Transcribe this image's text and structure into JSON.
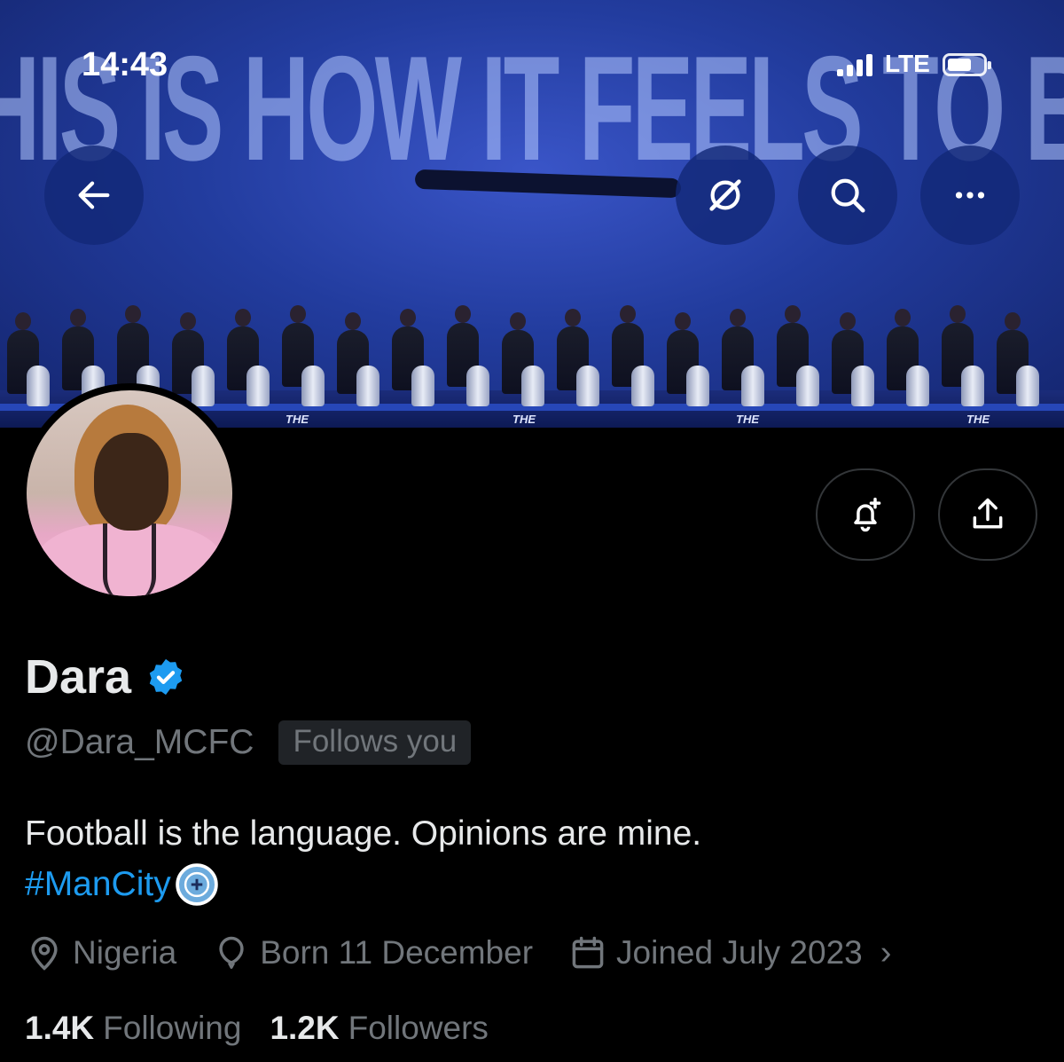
{
  "status_bar": {
    "time": "14:43",
    "network": "LTE"
  },
  "banner": {
    "slogan": "HIS IS HOW IT FEELS TO BE CIT",
    "stage_tag": "THE"
  },
  "profile": {
    "name": "Dara",
    "handle": "@Dara_MCFC",
    "follows_badge": "Follows you",
    "bio": "Football is the language. Opinions are mine.",
    "hashtag": "#ManCity",
    "location": "Nigeria",
    "birthday": "Born 11 December",
    "joined": "Joined July 2023",
    "following_count": "1.4K",
    "following_label": "Following",
    "followers_count": "1.2K",
    "followers_label": "Followers"
  },
  "icons": {
    "back": "arrow-left-icon",
    "grok": "grok-icon",
    "search": "search-icon",
    "more": "more-icon",
    "notify": "bell-plus-icon",
    "share": "share-icon",
    "verified": "verified-badge-icon",
    "location": "location-pin-icon",
    "birthday": "balloon-icon",
    "calendar": "calendar-icon"
  },
  "colors": {
    "accent": "#1d9bf0",
    "muted": "#71767b",
    "text": "#e7e9ea"
  }
}
